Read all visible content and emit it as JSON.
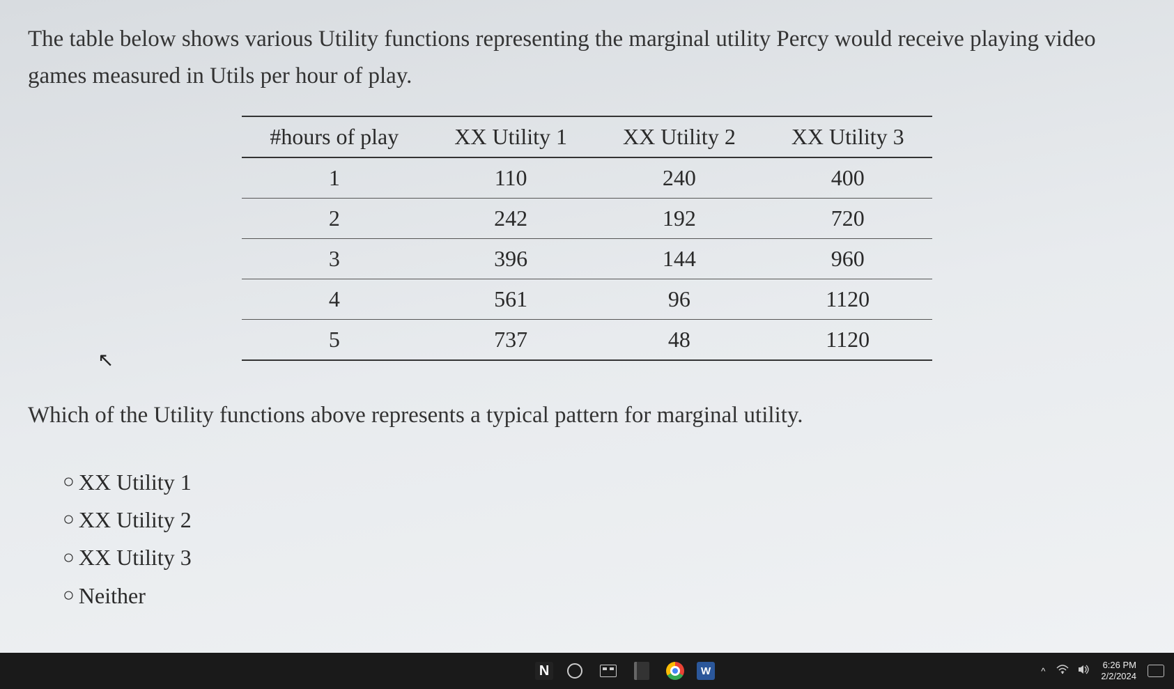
{
  "intro": "The table below shows various Utility functions representing the marginal utility Percy would receive playing video games measured in Utils per hour of play.",
  "table": {
    "headers": [
      "#hours of play",
      "XX Utility 1",
      "XX Utility 2",
      "XX Utility 3"
    ],
    "rows": [
      [
        "1",
        "110",
        "240",
        "400"
      ],
      [
        "2",
        "242",
        "192",
        "720"
      ],
      [
        "3",
        "396",
        "144",
        "960"
      ],
      [
        "4",
        "561",
        "96",
        "1120"
      ],
      [
        "5",
        "737",
        "48",
        "1120"
      ]
    ]
  },
  "question": "Which of the Utility functions above represents a typical pattern for marginal utility.",
  "options": {
    "o1": "XX Utility 1",
    "o2": "XX Utility 2",
    "o3": "XX Utility 3",
    "o4": "Neither"
  },
  "radio_glyph": "○",
  "taskbar": {
    "clock_time": "6:26 PM",
    "clock_date": "2/2/2024",
    "caret": "^"
  },
  "chart_data": {
    "type": "table",
    "title": "Marginal utility per hour of play",
    "columns": [
      "#hours of play",
      "XX Utility 1",
      "XX Utility 2",
      "XX Utility 3"
    ],
    "rows": [
      {
        "hours": 1,
        "utility1": 110,
        "utility2": 240,
        "utility3": 400
      },
      {
        "hours": 2,
        "utility1": 242,
        "utility2": 192,
        "utility3": 720
      },
      {
        "hours": 3,
        "utility1": 396,
        "utility2": 144,
        "utility3": 960
      },
      {
        "hours": 4,
        "utility1": 561,
        "utility2": 96,
        "utility3": 1120
      },
      {
        "hours": 5,
        "utility1": 737,
        "utility2": 48,
        "utility3": 1120
      }
    ]
  }
}
